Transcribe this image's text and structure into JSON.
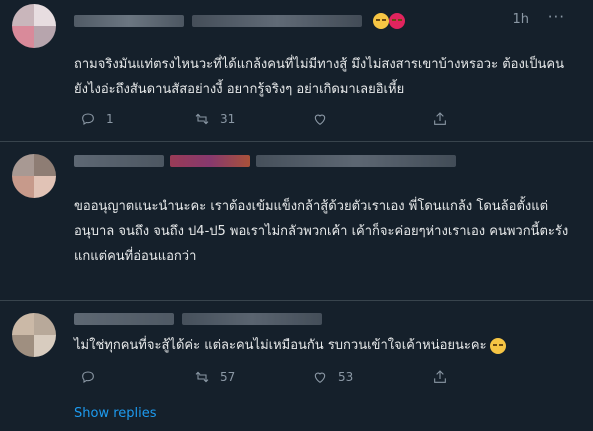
{
  "tweets": [
    {
      "time": "1h",
      "text": "ถามจริงมันแท่ตรงไหนวะที่ได้แกล้งคนที่ไม่มีทางสู้ มึงไม่สงสารเขาบ้างหรอวะ ต้องเป็นคนยังไงอ่ะถึงสันดานสัสอย่างงี้ อยากรู้จริงๆ อย่าเกิดมาเลยอิเหี้ย",
      "reply_count": "1",
      "retweet_count": "31",
      "like_count": "",
      "share": ""
    },
    {
      "text": "ขออนุญาตแนะนำนะคะ เราต้องเข้มแข็งกล้าสู้ด้วยตัวเราเอง พี่โดนแกล้ง โดนล้อตั้งแต่อนุบาล จนถึง จนถึง ป4-ป5 พอเราไม่กลัวพวกเค้า เค้าก็จะค่อยๆห่างเราเอง คนพวกนี้ตะรังแกแต่คนที่อ่อนแอกว่า"
    },
    {
      "text": "ไม่ใช่ทุกคนที่จะสู้ได้ค่ะ แต่ละคนไม่เหมือนกัน รบกวนเข้าใจเค้าหน่อยนะคะ",
      "emoji": "face-with-rolling-eyes",
      "reply_count": "",
      "retweet_count": "57",
      "like_count": "53",
      "share": ""
    }
  ],
  "show_replies": "Show replies",
  "colors": {
    "background": "#15202b",
    "text": "#e7e9ea",
    "muted": "#8b98a5",
    "link": "#1d9bf0",
    "divider": "#38444d"
  },
  "icons": [
    "reply-icon",
    "retweet-icon",
    "like-icon",
    "share-icon",
    "more-icon"
  ]
}
